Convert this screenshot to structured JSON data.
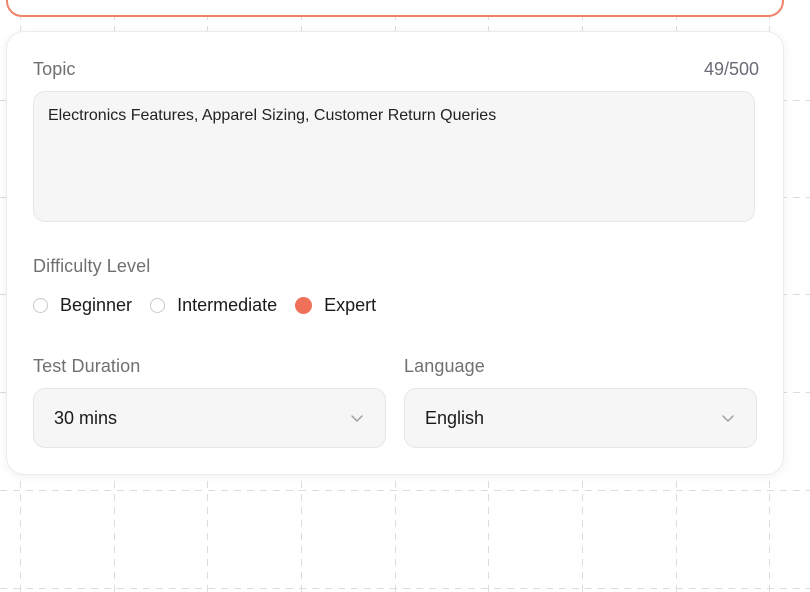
{
  "form": {
    "topic": {
      "label": "Topic",
      "counter": "49/500",
      "value": "Electronics Features, Apparel Sizing, Customer Return Queries"
    },
    "difficulty": {
      "label": "Difficulty Level",
      "options": [
        "Beginner",
        "Intermediate",
        "Expert"
      ],
      "selected": "Expert"
    },
    "duration": {
      "label": "Test Duration",
      "value": "30 mins"
    },
    "language": {
      "label": "Language",
      "value": "English"
    }
  },
  "colors": {
    "accent": "#f0715a",
    "top_card_border": "#f0826a"
  },
  "icons": {
    "duration_chevron": "chevron-down-icon",
    "language_chevron": "chevron-down-icon"
  }
}
